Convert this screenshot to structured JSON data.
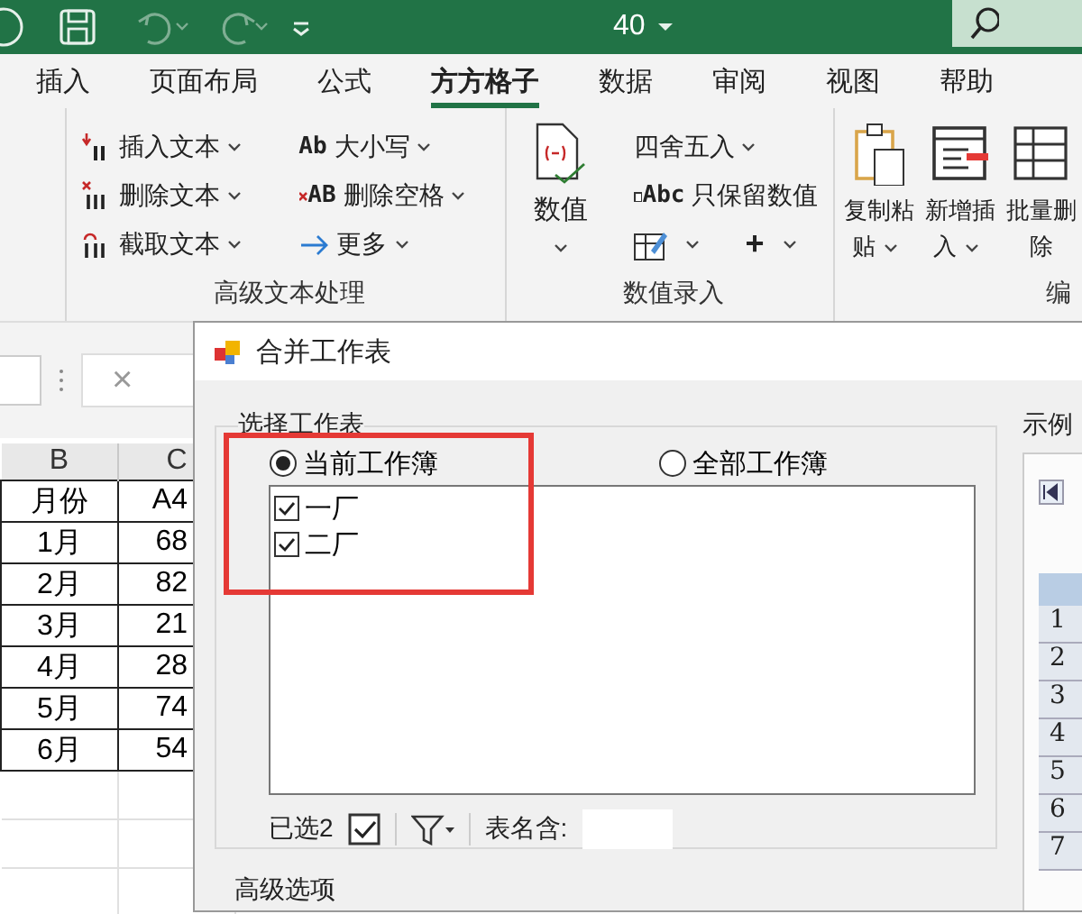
{
  "title_bar": {
    "center_text": "40"
  },
  "ribbon_tabs": [
    {
      "label": "插入",
      "selected": false
    },
    {
      "label": "页面布局",
      "selected": false
    },
    {
      "label": "公式",
      "selected": false
    },
    {
      "label": "方方格子",
      "selected": true
    },
    {
      "label": "数据",
      "selected": false
    },
    {
      "label": "审阅",
      "selected": false
    },
    {
      "label": "视图",
      "selected": false
    },
    {
      "label": "帮助",
      "selected": false
    }
  ],
  "ribbon_groups": [
    {
      "label": "高级文本处理",
      "buttons": [
        {
          "kind": "small",
          "text": "插入文本",
          "dropdown": true
        },
        {
          "kind": "small",
          "text": "删除文本",
          "dropdown": true
        },
        {
          "kind": "small",
          "text": "截取文本",
          "dropdown": true
        },
        {
          "kind": "small",
          "icon_text": "Ab",
          "text": "大小写",
          "dropdown": true
        },
        {
          "kind": "small",
          "icon_text": "AB",
          "text": "删除空格",
          "dropdown": true
        },
        {
          "kind": "small",
          "text": "更多",
          "dropdown": true
        }
      ]
    },
    {
      "label": "数值录入",
      "buttons": [
        {
          "kind": "large",
          "text": "数值",
          "dropdown": true
        },
        {
          "kind": "small",
          "text": "四舍五入",
          "dropdown": true
        },
        {
          "kind": "small",
          "icon_text": "Abc",
          "text": "只保留数值",
          "dropdown": false
        },
        {
          "kind": "icon",
          "dropdown": true
        },
        {
          "kind": "glyph",
          "text": "+",
          "dropdown": true
        }
      ]
    },
    {
      "label": "编",
      "buttons": [
        {
          "kind": "large",
          "text": "复制粘贴",
          "dropdown": true
        },
        {
          "kind": "large",
          "text": "新增插入",
          "dropdown": true
        },
        {
          "kind": "large",
          "text": "批量删除",
          "dropdown": false
        }
      ]
    }
  ],
  "formula_bar": {
    "cancel_symbol": "×"
  },
  "sheet": {
    "columns": [
      "B",
      "C"
    ],
    "rows": [
      [
        "月份",
        "A4"
      ],
      [
        "1月",
        "68"
      ],
      [
        "2月",
        "82"
      ],
      [
        "3月",
        "21"
      ],
      [
        "4月",
        "28"
      ],
      [
        "5月",
        "74"
      ],
      [
        "6月",
        "54"
      ]
    ]
  },
  "dialog": {
    "title": "合并工作表",
    "group_label": "选择工作表",
    "scope_options": [
      {
        "label": "当前工作簿",
        "selected": true
      },
      {
        "label": "全部工作簿",
        "selected": false
      }
    ],
    "sheets": [
      {
        "label": "一厂",
        "checked": true
      },
      {
        "label": "二厂",
        "checked": true
      }
    ],
    "selected_count": "已选2",
    "select_all": {
      "checked": true
    },
    "filter_label": "表名含:",
    "advanced_label": "高级选项",
    "preview": {
      "label": "示例",
      "row_numbers": [
        "1",
        "2",
        "3",
        "4",
        "5",
        "6",
        "7"
      ]
    }
  }
}
